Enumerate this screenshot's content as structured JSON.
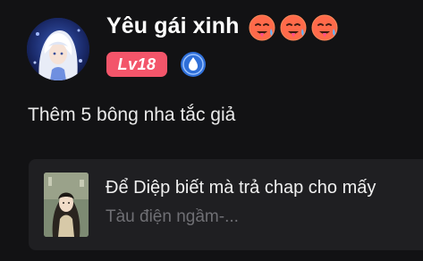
{
  "user": {
    "name": "Yêu gái xinh",
    "emoji_icons": [
      "hot-face-emoji-icon",
      "hot-face-emoji-icon",
      "hot-face-emoji-icon"
    ],
    "level": "Lv18",
    "avatar": "anime-character-avatar",
    "verified_icon": "blue-badge-icon"
  },
  "comment": {
    "text": "Thêm 5 bông nha tắc giả"
  },
  "reply_card": {
    "title": "Để Diệp biết mà trả chap cho mấy",
    "subtitle": "Tàu điện ngầm-..."
  },
  "colors": {
    "background": "#121214",
    "level_badge": "#f3556a",
    "verified_icon": "#2f6fd8",
    "card_background": "#1f1f22",
    "muted_text": "#6f6f74"
  }
}
